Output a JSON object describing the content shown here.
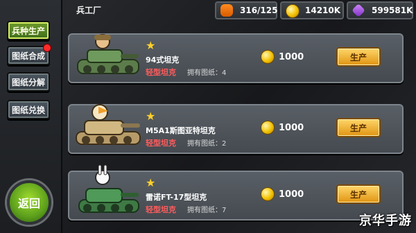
{
  "sidebar": {
    "items": [
      {
        "label": "兵种生产"
      },
      {
        "label": "图纸合成"
      },
      {
        "label": "图纸分解"
      },
      {
        "label": "图纸兑换"
      }
    ],
    "back_label": "返回"
  },
  "header": {
    "title": "兵工厂",
    "resources": {
      "fuel": "316/125",
      "gold": "14210K",
      "diamonds": "599581K"
    }
  },
  "tanks": [
    {
      "name": "94式坦克",
      "type": "轻型坦克",
      "blueprint_label": "拥有图纸：4",
      "cost": "1000",
      "button_label": "生产"
    },
    {
      "name": "M5A1斯图亚特坦克",
      "type": "轻型坦克",
      "blueprint_label": "拥有图纸：2",
      "cost": "1000",
      "button_label": "生产"
    },
    {
      "name": "雷诺FT-17型坦克",
      "type": "轻型坦克",
      "blueprint_label": "拥有图纸：7",
      "cost": "1000",
      "button_label": "生产"
    }
  ],
  "watermark": "京华手游",
  "colors": {
    "accent_green": "#6f9a2b",
    "button_gold": "#e09412",
    "tank_type_red": "#ff5c5c"
  },
  "icons": {
    "fuel": "carrot-icon",
    "gold": "coin-icon",
    "diamonds": "gem-icon",
    "rating": "star-icon"
  }
}
